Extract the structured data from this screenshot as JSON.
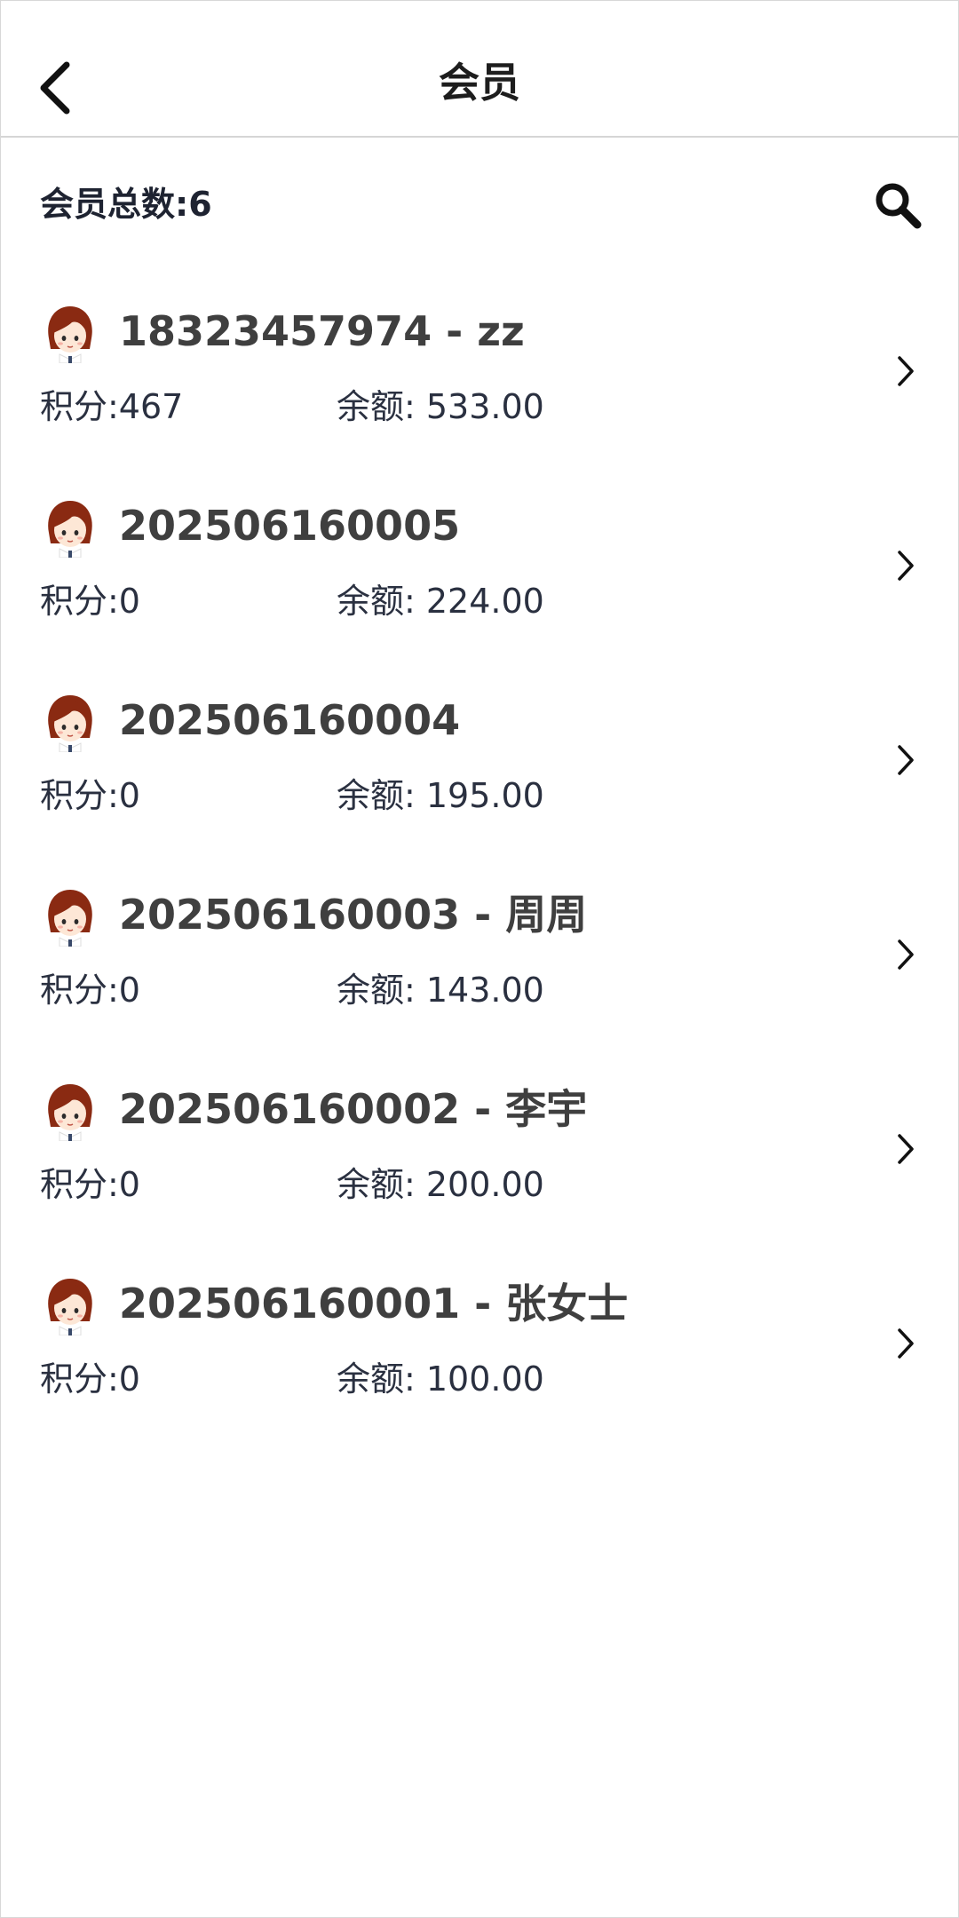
{
  "header": {
    "title": "会员",
    "back_icon": "chevron-left-icon"
  },
  "summary": {
    "total_text": "会员总数:6",
    "search_icon": "search-icon"
  },
  "members": [
    {
      "name": "18323457974 - zz",
      "points": "积分:467",
      "balance": "余额: 533.00"
    },
    {
      "name": "202506160005",
      "points": "积分:0",
      "balance": "余额: 224.00"
    },
    {
      "name": "202506160004",
      "points": "积分:0",
      "balance": "余额: 195.00"
    },
    {
      "name": "202506160003 - 周周",
      "points": "积分:0",
      "balance": "余额: 143.00"
    },
    {
      "name": "202506160002 - 李宇",
      "points": "积分:0",
      "balance": "余额: 200.00"
    },
    {
      "name": "202506160001 - 张女士",
      "points": "积分:0",
      "balance": "余额: 100.00"
    }
  ],
  "colors": {
    "title": "#1d1d1d",
    "name": "#3f3f3f",
    "meta": "#2a3040",
    "divider": "#d6d6d6"
  }
}
